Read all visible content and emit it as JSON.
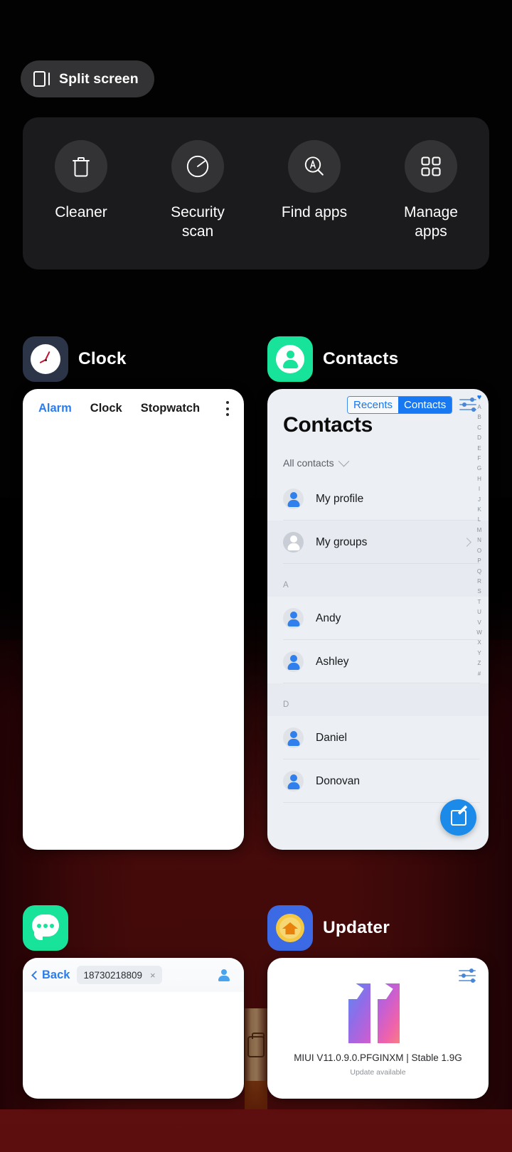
{
  "split_screen": {
    "label": "Split screen",
    "icon": "split-screen-icon"
  },
  "quick_actions": [
    {
      "label": "Cleaner",
      "icon": "trash-icon"
    },
    {
      "label": "Security\nscan",
      "icon": "gauge-icon"
    },
    {
      "label": "Find apps",
      "icon": "search-a-icon"
    },
    {
      "label": "Manage\napps",
      "icon": "grid-icon"
    }
  ],
  "apps": {
    "clock": {
      "title": "Clock",
      "icon": "clock-app-icon",
      "tabs": [
        {
          "label": "Alarm",
          "active": true
        },
        {
          "label": "Clock",
          "active": false
        },
        {
          "label": "Stopwatch",
          "active": false
        }
      ],
      "overflow": "more-options-icon"
    },
    "contacts": {
      "title": "Contacts",
      "icon": "contacts-app-icon",
      "segmented": {
        "left": "Recents",
        "right": "Contacts",
        "selected": "Contacts"
      },
      "settings_icon": "sliders-icon",
      "heading": "Contacts",
      "filter": "All contacts",
      "rows": [
        {
          "name": "My profile",
          "type": "profile"
        },
        {
          "name": "My groups",
          "type": "groups"
        },
        {
          "section": "A"
        },
        {
          "name": "Andy",
          "type": "contact"
        },
        {
          "name": "Ashley",
          "type": "contact"
        },
        {
          "section": "D"
        },
        {
          "name": "Daniel",
          "type": "contact"
        },
        {
          "name": "Donovan",
          "type": "contact"
        }
      ],
      "az_index": [
        "♥",
        "A",
        "B",
        "C",
        "D",
        "E",
        "F",
        "G",
        "H",
        "I",
        "J",
        "K",
        "L",
        "M",
        "N",
        "O",
        "P",
        "Q",
        "R",
        "S",
        "T",
        "U",
        "V",
        "W",
        "X",
        "Y",
        "Z",
        "#"
      ],
      "fab": "compose-icon"
    },
    "messaging": {
      "title": "",
      "icon": "messaging-app-icon",
      "back_label": "Back",
      "recipient_chip": "18730218809",
      "chip_close": "×",
      "contact_picker": "add-contact-icon"
    },
    "updater": {
      "title": "Updater",
      "icon": "updater-app-icon",
      "settings_icon": "sliders-icon",
      "logo": "miui-11-logo",
      "version_line": "MIUI V11.0.9.0.PFGINXM | Stable 1.9G",
      "status_line": "Update available"
    }
  },
  "colors": {
    "accent_blue": "#1778f2",
    "panel_dark": "#1b1b1d",
    "pill_dark": "#333335",
    "card_light": "#eceff3",
    "mint": "#18e39a"
  }
}
